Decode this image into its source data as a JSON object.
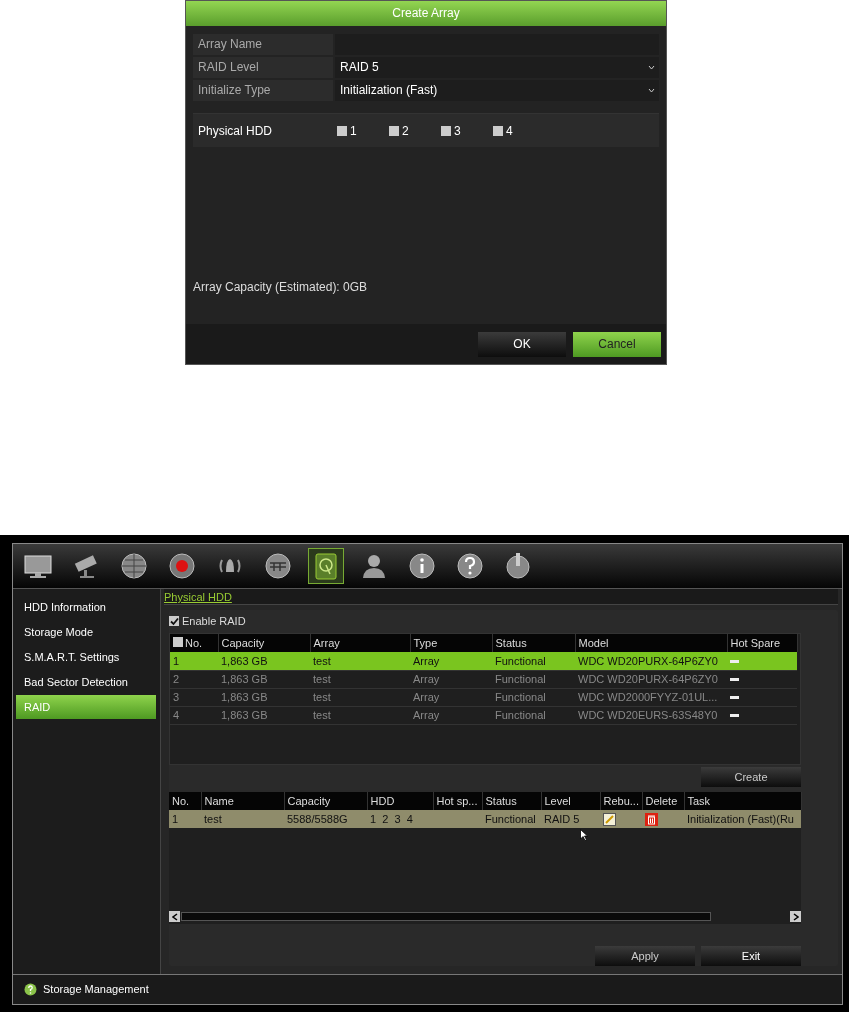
{
  "dialog": {
    "title": "Create Array",
    "fields": [
      {
        "label": "Array Name",
        "kind": "text"
      },
      {
        "label": "RAID Level",
        "kind": "select",
        "value": "RAID 5"
      },
      {
        "label": "Initialize Type",
        "kind": "select",
        "value": "Initialization (Fast)"
      }
    ],
    "physical_hdd": {
      "label": "Physical HDD",
      "disks": [
        {
          "label": "1",
          "checked": false
        },
        {
          "label": "2",
          "checked": false
        },
        {
          "label": "3",
          "checked": false
        },
        {
          "label": "4",
          "checked": false
        }
      ]
    },
    "capacity": "Array Capacity (Estimated): 0GB",
    "buttons": [
      {
        "label": "OK",
        "selected": false
      },
      {
        "label": "Cancel",
        "selected": true
      }
    ]
  },
  "window": {
    "toolbar": {
      "items": [
        {
          "selected": false
        },
        {
          "selected": false
        },
        {
          "selected": false
        },
        {
          "selected": false
        },
        {
          "selected": false
        },
        {
          "selected": false
        },
        {
          "selected": true
        },
        {
          "selected": false
        },
        {
          "selected": false
        },
        {
          "selected": false
        },
        {
          "selected": false
        }
      ]
    },
    "sidebar": {
      "items": [
        {
          "label": "HDD Information",
          "selected": false
        },
        {
          "label": "Storage Mode",
          "selected": false
        },
        {
          "label": "S.M.A.R.T. Settings",
          "selected": false
        },
        {
          "label": "Bad Sector Detection",
          "selected": false
        },
        {
          "label": "RAID",
          "selected": true
        }
      ]
    },
    "tabs": [
      {
        "label": "Physical HDD",
        "selected": true
      }
    ],
    "enable_raid": {
      "label": "Enable RAID",
      "checked": true
    },
    "disk_table": {
      "select_all_checked": false,
      "columns": [
        "No.",
        "Capacity",
        "Array",
        "Type",
        "Status",
        "Model",
        "Hot Spare"
      ],
      "rows": [
        {
          "selected": true,
          "no": "1",
          "capacity": "1,863 GB",
          "array": "test",
          "type": "Array",
          "status": "Functional",
          "model": "WDC WD20PURX-64P6ZY0"
        },
        {
          "selected": false,
          "no": "2",
          "capacity": "1,863 GB",
          "array": "test",
          "type": "Array",
          "status": "Functional",
          "model": "WDC WD20PURX-64P6ZY0"
        },
        {
          "selected": false,
          "no": "3",
          "capacity": "1,863 GB",
          "array": "test",
          "type": "Array",
          "status": "Functional",
          "model": "WDC WD2000FYYZ-01UL..."
        },
        {
          "selected": false,
          "no": "4",
          "capacity": "1,863 GB",
          "array": "test",
          "type": "Array",
          "status": "Functional",
          "model": "WDC WD20EURS-63S48Y0"
        }
      ]
    },
    "create_button": "Create",
    "array_table": {
      "columns": [
        "No.",
        "Name",
        "Capacity",
        "HDD",
        "Hot sp...",
        "Status",
        "Level",
        "Rebu...",
        "Delete",
        "Task"
      ],
      "rows": [
        {
          "selected": true,
          "no": "1",
          "name": "test",
          "capacity": "5588/5588G",
          "hdd": "1  2  3  4",
          "status": "Functional",
          "level": "RAID 5",
          "task": "Initialization (Fast)(Ru"
        }
      ]
    },
    "buttons": [
      "Apply",
      "Exit"
    ],
    "status_bar": "Storage Management"
  }
}
